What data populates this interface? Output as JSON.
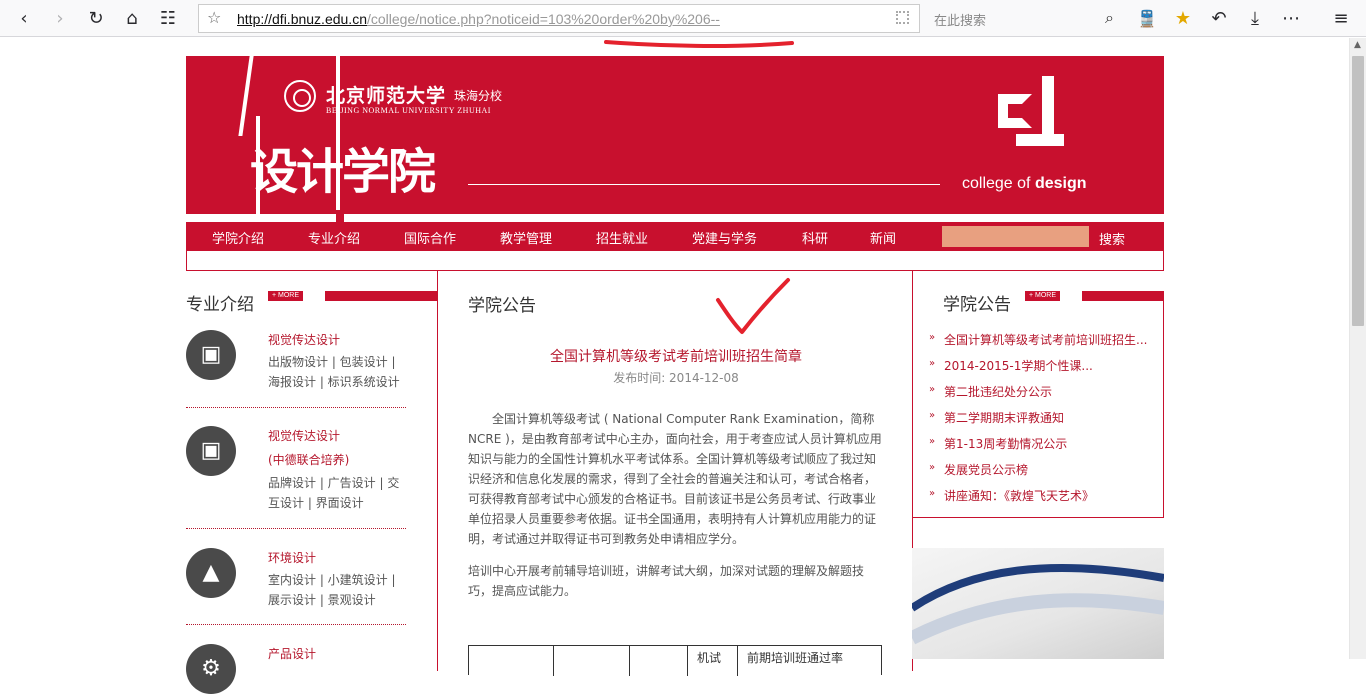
{
  "browser": {
    "url_host": "http://dfi.bnuz.edu.cn",
    "url_path": "/college/notice.php?noticeid=103%20order%20by%206--",
    "search_placeholder": "在此搜索"
  },
  "banner": {
    "university_cn": "北京师范大学",
    "campus_cn": "珠海分校",
    "university_en": "BEIJING NORMAL UNIVERSITY  ZHUHAI",
    "college_cn": "设计学院",
    "college_en_prefix": "college of ",
    "college_en_bold": "design"
  },
  "nav": {
    "items": [
      "学院介绍",
      "专业介绍",
      "国际合作",
      "教学管理",
      "招生就业",
      "党建与学务",
      "科研",
      "新闻"
    ],
    "search_label": "搜索"
  },
  "majors_section": {
    "title": "专业介绍",
    "more": "+ MORE",
    "items": [
      {
        "icon": "camera-icon",
        "title": "视觉传达设计",
        "subtitle": "",
        "desc1": "出版物设计 | 包装设计 |",
        "desc2": "海报设计 | 标识系统设计"
      },
      {
        "icon": "camera-icon",
        "title": "视觉传达设计",
        "subtitle": "(中德联合培养)",
        "desc1": "品牌设计 | 广告设计 | 交",
        "desc2": "互设计 | 界面设计"
      },
      {
        "icon": "tree-icon",
        "title": "环境设计",
        "subtitle": "",
        "desc1": "室内设计 | 小建筑设计 |",
        "desc2": "展示设计 | 景观设计"
      },
      {
        "icon": "product-icon",
        "title": "产品设计",
        "subtitle": "",
        "desc1": "",
        "desc2": ""
      }
    ]
  },
  "notice": {
    "section_title": "学院公告",
    "title": "全国计算机等级考试考前培训班招生简章",
    "date": "发布时间: 2014-12-08",
    "para1": "全国计算机等级考试 ( National Computer Rank Examination，简称NCRE )，是由教育部考试中心主办，面向社会，用于考查应试人员计算机应用知识与能力的全国性计算机水平考试体系。全国计算机等级考试顺应了我过知识经济和信息化发展的需求，得到了全社会的普遍关注和认可，考试合格者，可获得教育部考试中心颁发的合格证书。目前该证书是公务员考试、行政事业单位招录人员重要参考依据。证书全国通用，表明持有人计算机应用能力的证明，考试通过并取得证书可到教务处申请相应学分。",
    "para2": "培训中心开展考前辅导培训班，讲解考试大纲，加深对试题的理解及解题技巧，提高应试能力。",
    "table_cell_a": "机试",
    "table_cell_b": "前期培训班通过率"
  },
  "right_notices": {
    "title": "学院公告",
    "more": "+ MORE",
    "items": [
      "全国计算机等级考试考前培训班招生...",
      "2014-2015-1学期个性课...",
      "第二批违纪处分公示",
      "第二学期期末评教通知",
      "第1-13周考勤情况公示",
      "发展党员公示榜",
      "讲座通知：《敦煌飞天艺术》"
    ]
  }
}
